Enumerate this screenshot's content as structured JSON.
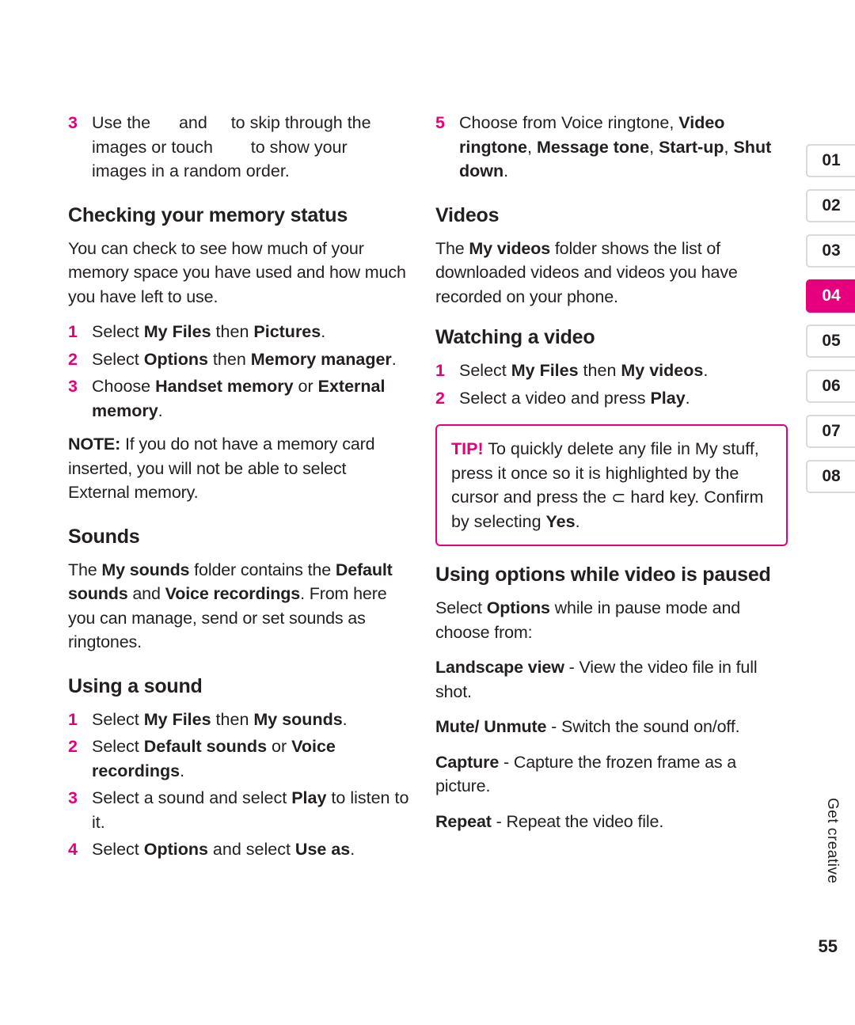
{
  "document": {
    "page_number": "55",
    "side_label": "Get creative"
  },
  "tabs": [
    {
      "label": "01",
      "active": false
    },
    {
      "label": "02",
      "active": false
    },
    {
      "label": "03",
      "active": false
    },
    {
      "label": "04",
      "active": true
    },
    {
      "label": "05",
      "active": false
    },
    {
      "label": "06",
      "active": false
    },
    {
      "label": "07",
      "active": false
    },
    {
      "label": "08",
      "active": false
    }
  ],
  "left_column": {
    "step3_top": {
      "num": "3",
      "line1_a": "Use the",
      "line1_b": "and",
      "line1_c": "to skip through the",
      "line2_a": "images or touch",
      "line2_b": "to show your",
      "line3": "images in a random order."
    },
    "heading_memory": "Checking your memory status",
    "memory_para": "You can check to see how much of your memory space you have used and how much you have left to use.",
    "memory_steps": [
      {
        "num": "1",
        "pre": "Select ",
        "b1": "My Files",
        "mid": " then ",
        "b2": "Pictures",
        "post": "."
      },
      {
        "num": "2",
        "pre": "Select ",
        "b1": "Options",
        "mid": " then ",
        "b2": "Memory manager",
        "post": "."
      },
      {
        "num": "3",
        "pre": "Choose ",
        "b1": "Handset memory",
        "mid": " or ",
        "b2": "External memory",
        "post": "."
      }
    ],
    "note": {
      "label": "NOTE:",
      "text": " If you do not have a memory card inserted, you will not be able to select External memory."
    },
    "heading_sounds": "Sounds",
    "sounds_para": {
      "t1": "The ",
      "b1": "My sounds",
      "t2": " folder contains the ",
      "b2": "Default sounds",
      "t3": " and ",
      "b3": "Voice recordings",
      "t4": ". From here you can manage, send or set sounds as ringtones."
    },
    "heading_using_sound": "Using a sound",
    "sound_steps": [
      {
        "num": "1",
        "pre": "Select ",
        "b1": "My Files",
        "mid": " then ",
        "b2": "My sounds",
        "post": "."
      },
      {
        "num": "2",
        "pre": "Select ",
        "b1": "Default sounds",
        "mid": " or ",
        "b2": "Voice recordings",
        "post": "."
      },
      {
        "num": "3",
        "pre": "Select a sound and select ",
        "b1": "Play",
        "mid": " to listen to it.",
        "b2": "",
        "post": ""
      },
      {
        "num": "4",
        "pre": "Select ",
        "b1": "Options",
        "mid": " and select ",
        "b2": "Use as",
        "post": "."
      }
    ]
  },
  "right_column": {
    "step5": {
      "num": "5",
      "pre": "Choose from Voice ringtone, ",
      "b1": "Video ringtone",
      "sep1": ", ",
      "b2": "Message tone",
      "sep2": ", ",
      "b3": "Start-up",
      "sep3": ", ",
      "b4": "Shut down",
      "post": "."
    },
    "heading_videos": "Videos",
    "videos_para": {
      "t1": "The ",
      "b1": "My videos",
      "t2": " folder shows the list of downloaded videos and videos you have recorded on your phone."
    },
    "heading_watching": "Watching a video",
    "watch_steps": [
      {
        "num": "1",
        "pre": "Select ",
        "b1": "My Files",
        "mid": " then ",
        "b2": "My videos",
        "post": "."
      },
      {
        "num": "2",
        "pre": "Select a video and press ",
        "b1": "Play",
        "mid": ".",
        "b2": "",
        "post": ""
      }
    ],
    "tip": {
      "label": "TIP!",
      "t1": " To quickly delete any file in My stuff, press it once so it is highlighted by the cursor and press the ",
      "key_icon": "clear-hard-key-icon",
      "t2": " hard key. Confirm by selecting ",
      "b1": "Yes",
      "t3": "."
    },
    "heading_using_options": "Using options while video is paused",
    "options_intro": {
      "t1": "Select ",
      "b1": "Options",
      "t2": " while in pause mode and choose from:"
    },
    "option_items": [
      {
        "term": "Landscape view",
        "desc": " - View the video file in full shot."
      },
      {
        "term": "Mute/ Unmute",
        "desc": " - Switch the sound on/off."
      },
      {
        "term": "Capture",
        "desc": " - Capture the frozen frame as a picture."
      },
      {
        "term": "Repeat",
        "desc": " - Repeat the video file."
      }
    ]
  }
}
